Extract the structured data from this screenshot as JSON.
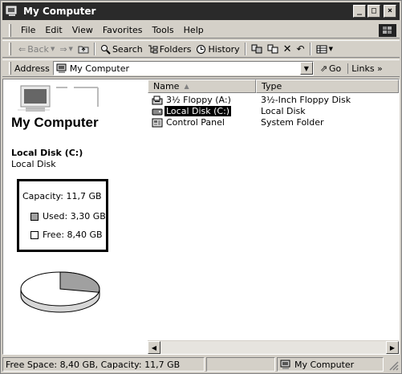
{
  "window": {
    "title": "My Computer"
  },
  "title_buttons": {
    "minimize": "_",
    "maximize": "□",
    "close": "×"
  },
  "menu": {
    "items": [
      "File",
      "Edit",
      "View",
      "Favorites",
      "Tools",
      "Help"
    ]
  },
  "toolbar": {
    "back_label": "Back",
    "search_label": "Search",
    "folders_label": "Folders",
    "history_label": "History"
  },
  "address": {
    "label": "Address",
    "value": "My Computer",
    "go_label": "Go",
    "links_label": "Links »"
  },
  "left_panel": {
    "title": "My Computer",
    "selected_name": "Local Disk (C:)",
    "selected_type": "Local Disk",
    "capacity": "Capacity: 11,7 GB",
    "used": "Used: 3,30 GB",
    "free": "Free: 8,40 GB",
    "pie": {
      "used_fraction": 0.282,
      "free_fraction": 0.718
    }
  },
  "list": {
    "columns": [
      "Name",
      "Type"
    ],
    "rows": [
      {
        "name": "3½ Floppy (A:)",
        "type": "3½-Inch Floppy Disk",
        "icon": "floppy-drive-icon",
        "selected": false
      },
      {
        "name": "Local Disk (C:)",
        "type": "Local Disk",
        "icon": "hard-disk-icon",
        "selected": true
      },
      {
        "name": "Control Panel",
        "type": "System Folder",
        "icon": "control-panel-icon",
        "selected": false
      }
    ]
  },
  "status": {
    "left": "Free Space: 8,40 GB, Capacity: 11,7 GB",
    "middle": "",
    "right": "My Computer"
  },
  "colors": {
    "titlebar": "#2a2a2a",
    "face": "#d4d0c8",
    "selection": "#000000"
  }
}
